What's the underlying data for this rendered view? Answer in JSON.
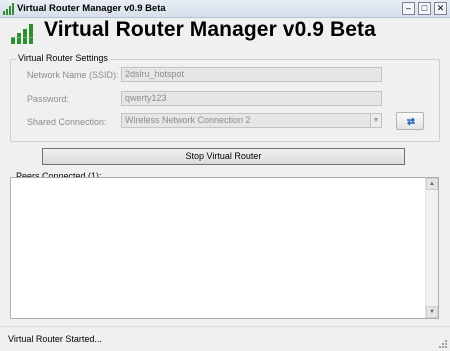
{
  "window": {
    "title": "Virtual Router Manager v0.9 Beta",
    "minimize_glyph": "–",
    "maximize_glyph": "□",
    "close_glyph": "✕"
  },
  "header": {
    "title": "Virtual Router Manager v0.9 Beta"
  },
  "settings": {
    "legend": "Virtual Router Settings",
    "ssid_label": "Network Name (SSID):",
    "ssid_value": "2dslru_hotspot",
    "password_label": "Password:",
    "password_value": "qwerty123",
    "shared_label": "Shared Connection:",
    "shared_value": "Wireless Network Connection 2"
  },
  "actions": {
    "main_label": "Stop Virtual Router"
  },
  "peers": {
    "legend": "Peers Connected (1):"
  },
  "status": {
    "text": "Virtual Router Started..."
  },
  "icons": {
    "app": "signal-bars-icon",
    "refresh": "refresh-arrows-icon",
    "dropdown": "chevron-down-icon"
  },
  "colors": {
    "accent_green": "#2f8f2f",
    "refresh_blue": "#2b64c5"
  }
}
